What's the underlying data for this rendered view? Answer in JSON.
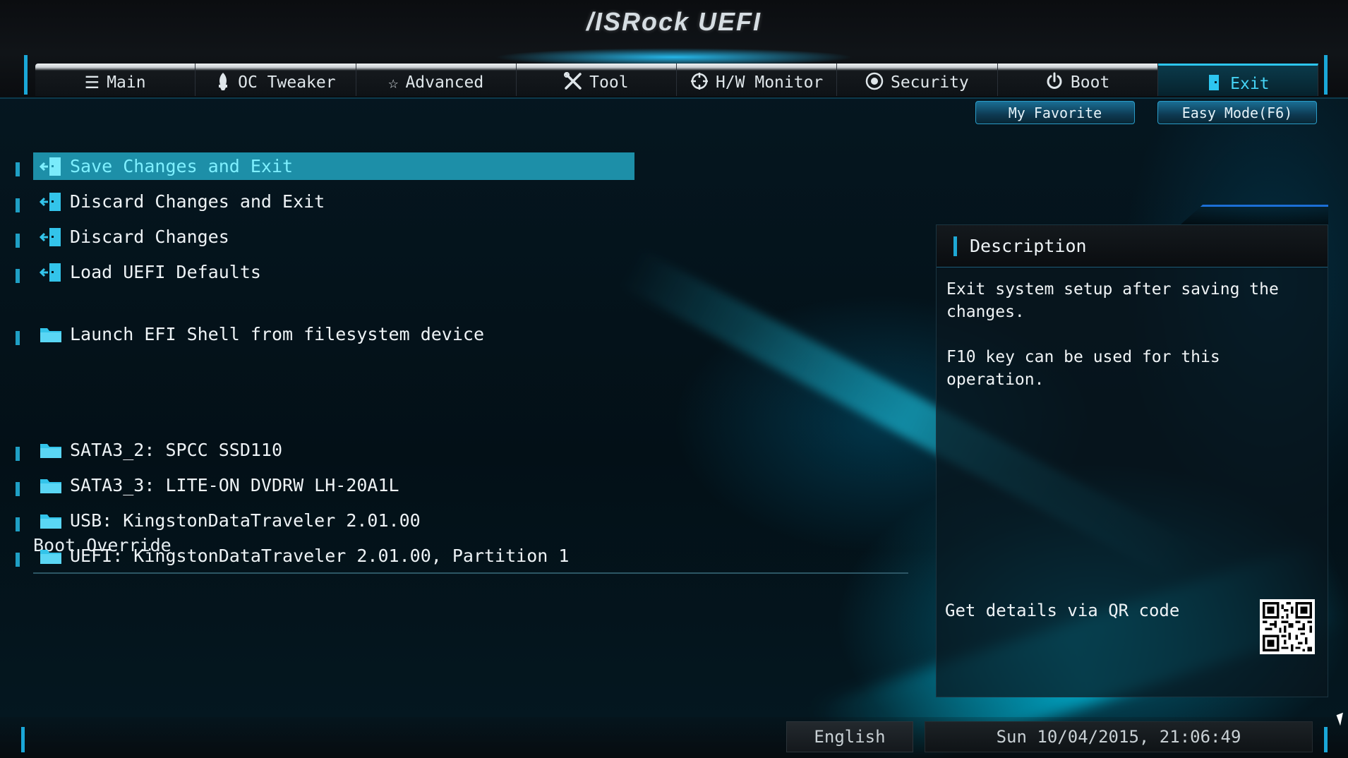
{
  "brand": {
    "title": "/ISRock UEFI"
  },
  "tabs": [
    {
      "label": "Main",
      "icon": "list-icon"
    },
    {
      "label": "OC Tweaker",
      "icon": "rocket-icon"
    },
    {
      "label": "Advanced",
      "icon": "star-icon"
    },
    {
      "label": "Tool",
      "icon": "tools-icon"
    },
    {
      "label": "H/W Monitor",
      "icon": "target-icon"
    },
    {
      "label": "Security",
      "icon": "shield-icon"
    },
    {
      "label": "Boot",
      "icon": "power-icon"
    },
    {
      "label": "Exit",
      "icon": "exit-door-icon",
      "active": true
    }
  ],
  "top_buttons": {
    "favorite": "My Favorite",
    "easy_mode": "Easy Mode(F6)"
  },
  "menu": {
    "items": [
      {
        "label": "Save Changes and Exit",
        "icon": "exit-door-icon",
        "selected": true
      },
      {
        "label": "Discard Changes and Exit",
        "icon": "exit-door-icon"
      },
      {
        "label": "Discard Changes",
        "icon": "exit-door-icon"
      },
      {
        "label": "Load UEFI Defaults",
        "icon": "exit-door-icon"
      },
      {
        "label": "Launch EFI Shell from filesystem device",
        "icon": "folder-icon"
      }
    ],
    "boot_override_label": "Boot Override",
    "boot_devices": [
      {
        "label": "SATA3_2: SPCC SSD110",
        "icon": "folder-icon"
      },
      {
        "label": "SATA3_3: LITE-ON DVDRW LH-20A1L",
        "icon": "folder-icon"
      },
      {
        "label": "USB: KingstonDataTraveler 2.01.00",
        "icon": "folder-icon"
      },
      {
        "label": "UEFI: KingstonDataTraveler 2.01.00, Partition 1",
        "icon": "folder-icon"
      }
    ]
  },
  "description": {
    "title": "Description",
    "text": "Exit system setup after saving the\nchanges.\n\nF10 key can be used for this operation.",
    "qr_label": "Get details via QR code"
  },
  "footer": {
    "language": "English",
    "datetime": "Sun 10/04/2015, 21:06:49"
  },
  "colors": {
    "accent": "#1ea8d5",
    "selected_row": "#1d8fa8",
    "selected_text": "#7ff0ff",
    "active_tab_text": "#45d3f5"
  }
}
